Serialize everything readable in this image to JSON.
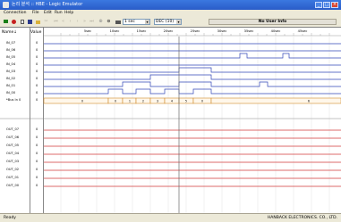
{
  "window": {
    "title": "논리 분석 :: HBE - Logic Emulator",
    "controls": [
      "_",
      "□",
      "×"
    ]
  },
  "menu": [
    "Connection",
    "File",
    "Edit",
    "Run",
    "Help"
  ],
  "toolbar": {
    "icons": [
      "stop-icon",
      "record-icon",
      "new-file-icon",
      "save-icon",
      "open-icon",
      "cut-icon",
      "go-start-icon",
      "go-back-icon",
      "prev-icon",
      "next-icon",
      "go-forward-icon",
      "go-end-icon",
      "zoom-in-icon",
      "zoom-out-icon",
      "print-icon"
    ],
    "time_select": "1 sec",
    "format_select": "DEC (10)",
    "user_info": "No User Info"
  },
  "waveform": {
    "name_header": "Name↓",
    "value_header": "Value",
    "time_ticks": [
      "5sec",
      "10sec",
      "15sec",
      "20sec",
      "25sec",
      "30sec",
      "35sec",
      "40sec",
      "45sec"
    ],
    "inputs": [
      {
        "name": "IN_07",
        "value": "0"
      },
      {
        "name": "IN_06",
        "value": "0"
      },
      {
        "name": "IN_05",
        "value": "0"
      },
      {
        "name": "IN_04",
        "value": "0"
      },
      {
        "name": "IN_03",
        "value": "0"
      },
      {
        "name": "IN_02",
        "value": "0"
      },
      {
        "name": "IN_01",
        "value": "0"
      },
      {
        "name": "IN_00",
        "value": "0"
      },
      {
        "name": "*Bus In 0",
        "value": "0"
      }
    ],
    "bus_values": [
      "0",
      "1",
      "2",
      "3",
      "4",
      "5",
      "6"
    ],
    "outputs": [
      {
        "name": "OUT_07",
        "value": "0"
      },
      {
        "name": "OUT_06",
        "value": "0"
      },
      {
        "name": "OUT_05",
        "value": "0"
      },
      {
        "name": "OUT_04",
        "value": "0"
      },
      {
        "name": "OUT_03",
        "value": "0"
      },
      {
        "name": "OUT_02",
        "value": "0"
      },
      {
        "name": "OUT_01",
        "value": "0"
      },
      {
        "name": "OUT_00",
        "value": "0"
      }
    ]
  },
  "status": {
    "left": "Ready",
    "right": "HANBACK ELECTRONICS. CO., LTD."
  }
}
